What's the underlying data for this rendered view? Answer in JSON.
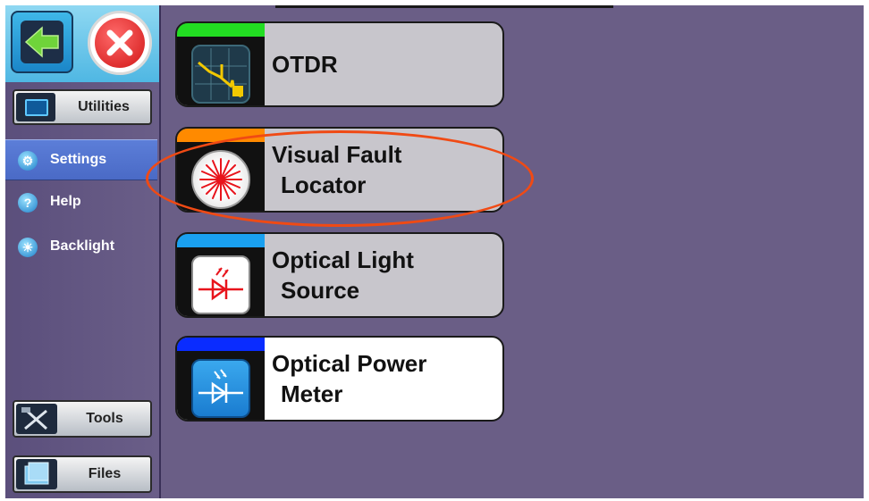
{
  "sidebar": {
    "utilities_label": "Utilities",
    "nav": [
      {
        "label": "Settings",
        "active": true
      },
      {
        "label": "Help",
        "active": false
      },
      {
        "label": "Backlight",
        "active": false
      }
    ],
    "tools_label": "Tools",
    "files_label": "Files"
  },
  "cards": [
    {
      "line1": "OTDR",
      "line2": "",
      "bar_color": "#22dd22",
      "icon": "otdr-trace-icon"
    },
    {
      "line1": "Visual Fault",
      "line2": "Locator",
      "bar_color": "#ff8a00",
      "icon": "laser-burst-icon"
    },
    {
      "line1": "Optical Light",
      "line2": "Source",
      "bar_color": "#1aa0f0",
      "icon": "light-source-diode-icon"
    },
    {
      "line1": "Optical Power",
      "line2": "Meter",
      "bar_color": "#0a2cff",
      "icon": "power-meter-diode-icon"
    }
  ],
  "colors": {
    "background": "#6a5e86",
    "highlight_ring": "#f04a14",
    "close_red": "#d11616",
    "back_green": "#6fd43a"
  }
}
